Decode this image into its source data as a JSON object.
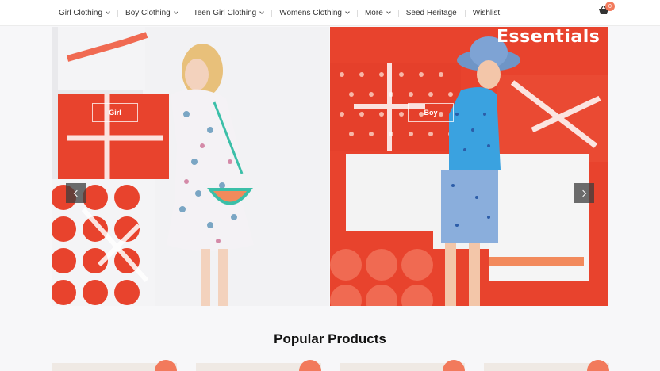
{
  "nav": {
    "items": [
      {
        "label": "Girl Clothing",
        "dropdown": true
      },
      {
        "label": "Boy Clothing",
        "dropdown": true
      },
      {
        "label": "Teen Girl Clothing",
        "dropdown": true
      },
      {
        "label": "Womens Clothing",
        "dropdown": true
      },
      {
        "label": "More",
        "dropdown": true
      },
      {
        "label": "Seed Heritage",
        "dropdown": false
      },
      {
        "label": "Wishlist",
        "dropdown": false
      }
    ],
    "cart_count": "0"
  },
  "banners": {
    "left": {
      "button": "Girl"
    },
    "right": {
      "headline": "Essentials",
      "button": "Boy"
    }
  },
  "sections": {
    "popular_title": "Popular Products"
  },
  "colors": {
    "accent": "#f27a5c",
    "banner_red": "#e8432d"
  },
  "icons": [
    "cart-icon",
    "chevron-left-icon",
    "chevron-right-icon",
    "caret-down-icon"
  ]
}
